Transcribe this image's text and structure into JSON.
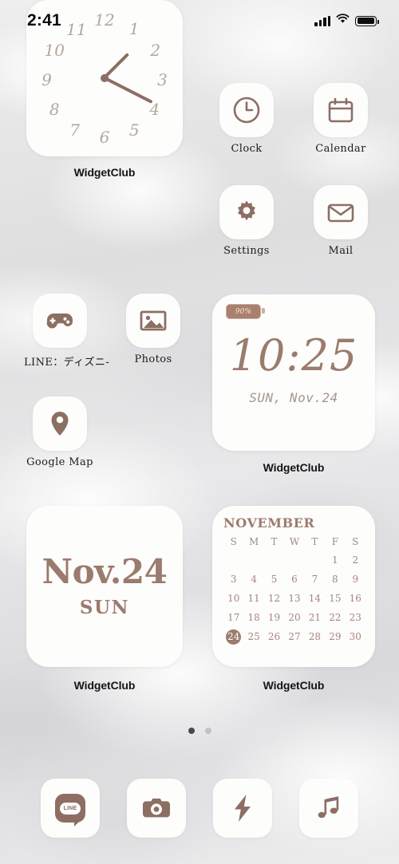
{
  "status_bar": {
    "time": "2:41",
    "signal_icon": "cellular-signal-icon",
    "wifi_icon": "wifi-icon",
    "battery_icon": "battery-icon"
  },
  "theme": {
    "accent_brown": "#8d6e63",
    "muted_brown": "#9b7b6d",
    "numeral_tan": "#b5a79c",
    "tile_white": "#fdfdfc",
    "wallpaper": "#e4e4e5"
  },
  "clock_widget": {
    "label": "WidgetClub",
    "numerals": [
      "12",
      "1",
      "2",
      "3",
      "4",
      "5",
      "6",
      "7",
      "8",
      "9",
      "10",
      "11"
    ],
    "hour_hand_deg": -45,
    "minute_hand_deg": 27
  },
  "apps_row1": [
    {
      "label": "Clock",
      "icon": "clock-icon"
    },
    {
      "label": "Calendar",
      "icon": "calendar-icon"
    },
    {
      "label": "Settings",
      "icon": "gear-icon"
    },
    {
      "label": "Mail",
      "icon": "envelope-icon"
    }
  ],
  "apps_row2": [
    {
      "label": "LINE：ディズニ-",
      "icon": "gamepad-icon"
    },
    {
      "label": "Photos",
      "icon": "photo-icon"
    },
    {
      "label": "Google Map",
      "icon": "map-pin-icon"
    }
  ],
  "digital_widget": {
    "battery": "90%",
    "time": "10:25",
    "date": "SUN, Nov.24",
    "label": "WidgetClub"
  },
  "date_widget": {
    "date": "Nov.24",
    "day_of_week": "SUN",
    "label": "WidgetClub"
  },
  "calendar_widget": {
    "month": "NOVEMBER",
    "weekdays": [
      "S",
      "M",
      "T",
      "W",
      "T",
      "F",
      "S"
    ],
    "lead_blanks": 5,
    "days": [
      1,
      2,
      3,
      4,
      5,
      6,
      7,
      8,
      9,
      10,
      11,
      12,
      13,
      14,
      15,
      16,
      17,
      18,
      19,
      20,
      21,
      22,
      23,
      24,
      25,
      26,
      27,
      28,
      29,
      30
    ],
    "today": 24,
    "label": "WidgetClub"
  },
  "page_dots": {
    "count": 2,
    "active_index": 0
  },
  "dock": [
    {
      "name": "line",
      "icon": "line-chat-icon",
      "text": "LINE"
    },
    {
      "name": "camera",
      "icon": "camera-icon"
    },
    {
      "name": "shortcuts",
      "icon": "lightning-bolt-icon"
    },
    {
      "name": "music",
      "icon": "music-note-icon"
    }
  ]
}
